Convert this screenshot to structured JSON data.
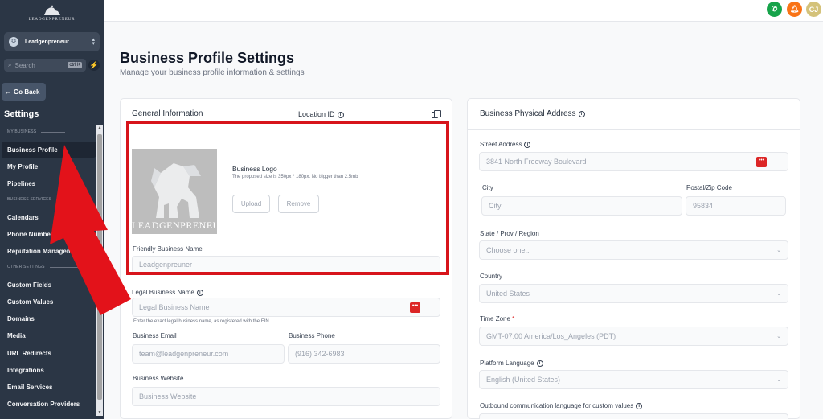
{
  "sidebar": {
    "logo_text": "LEADGENPRENEUR",
    "account_name": "Leadgenpreneur",
    "search_placeholder": "Search",
    "search_shortcut": "ctrl K",
    "go_back": "Go Back",
    "title": "Settings",
    "sections": {
      "my_business": "MY BUSINESS",
      "business_services": "BUSINESS SERVICES",
      "other_settings": "OTHER SETTINGS"
    },
    "items": [
      {
        "label": "Business Profile",
        "active": true
      },
      {
        "label": "My Profile"
      },
      {
        "label": "Pipelines"
      },
      {
        "label": "Calendars"
      },
      {
        "label": "Phone Numbers"
      },
      {
        "label": "Reputation Management"
      },
      {
        "label": "Custom Fields"
      },
      {
        "label": "Custom Values"
      },
      {
        "label": "Domains"
      },
      {
        "label": "Media"
      },
      {
        "label": "URL Redirects"
      },
      {
        "label": "Integrations"
      },
      {
        "label": "Email Services"
      },
      {
        "label": "Conversation Providers"
      }
    ]
  },
  "topbar": {
    "avatar_initials": "CJ",
    "phone_color": "#16a34a",
    "bell_color": "#f97316",
    "avatar_color": "#d4c27a"
  },
  "page": {
    "title": "Business Profile Settings",
    "subtitle": "Manage your business profile information & settings"
  },
  "general": {
    "header": "General Information",
    "location_id_label": "Location ID",
    "logo_title": "Business Logo",
    "logo_hint": "The proposed size is 350px * 180px. No bigger than 2.5mb",
    "logo_caption": "LEADGENPRENEUR",
    "upload": "Upload",
    "remove": "Remove",
    "friendly_name_label": "Friendly Business Name",
    "friendly_name_value": "Leadgenpreuner",
    "legal_name_label": "Legal Business Name",
    "legal_name_placeholder": "Legal Business Name",
    "legal_name_hint": "Enter the exact legal business name, as registered with the EIN",
    "email_label": "Business Email",
    "email_value": "team@leadgenpreneur.com",
    "phone_label": "Business Phone",
    "phone_value": "(916) 342-6983",
    "website_label": "Business Website",
    "website_placeholder": "Business Website"
  },
  "address": {
    "header": "Business Physical Address",
    "street_label": "Street Address",
    "street_value": "3841 North Freeway Boulevard",
    "city_label": "City",
    "city_placeholder": "City",
    "zip_label": "Postal/Zip Code",
    "zip_value": "95834",
    "state_label": "State / Prov / Region",
    "state_placeholder": "Choose one..",
    "country_label": "Country",
    "country_value": "United States",
    "timezone_label": "Time Zone",
    "timezone_required": "*",
    "timezone_value": "GMT-07:00 America/Los_Angeles (PDT)",
    "language_label": "Platform Language",
    "language_value": "English (United States)",
    "outbound_label": "Outbound communication language for custom values"
  },
  "annotation": {
    "highlight_color": "#d7141b",
    "arrow_color": "#e3121a"
  }
}
